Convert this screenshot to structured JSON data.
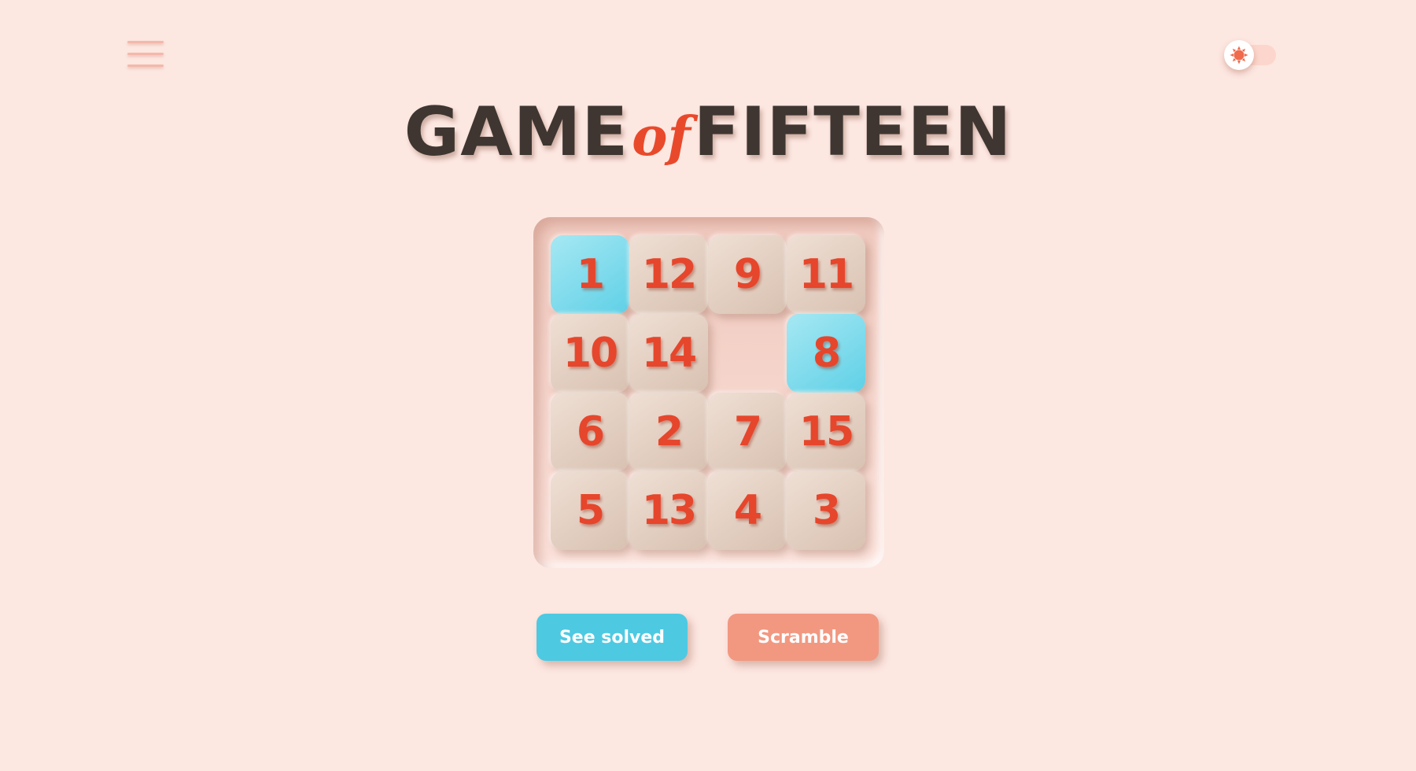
{
  "title": {
    "part1": "GAME",
    "part2": "of",
    "part3": "FIFTEEN"
  },
  "colors": {
    "background": "#fde7e1",
    "title_dark": "#3f3631",
    "accent_red": "#e9492b",
    "tile": "#e4d0c2",
    "tile_highlight": "#5fd0e6",
    "button_solved": "#4ec9e2",
    "button_scramble": "#f29881"
  },
  "icons": {
    "menu": "hamburger-icon",
    "theme": "sun-icon"
  },
  "board": {
    "rows": 4,
    "cols": 4,
    "tiles": [
      [
        "1",
        "12",
        "9",
        "11"
      ],
      [
        "10",
        "14",
        "",
        "8"
      ],
      [
        "6",
        "2",
        "7",
        "15"
      ],
      [
        "5",
        "13",
        "4",
        "3"
      ]
    ],
    "highlighted": [
      "1",
      "8"
    ]
  },
  "buttons": {
    "see_solved": "See solved",
    "scramble": "Scramble"
  }
}
